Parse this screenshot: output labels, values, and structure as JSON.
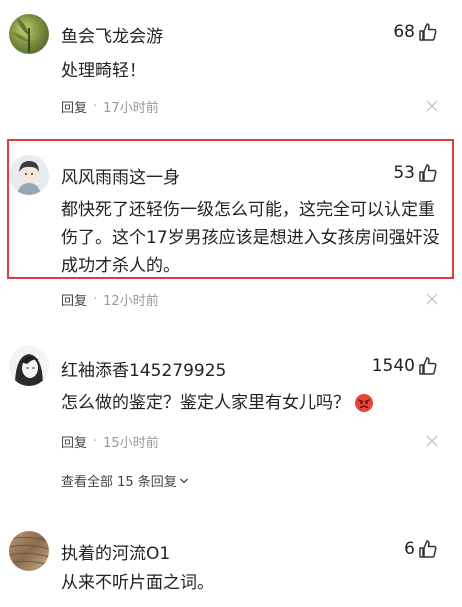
{
  "comments": [
    {
      "username": "鱼会飞龙会游",
      "likes": "68",
      "text": "处理畸轻！",
      "reply_label": "回复",
      "time": "17小时前",
      "avatar": "plant-avatar"
    },
    {
      "username": "风风雨雨这一身",
      "likes": "53",
      "text": "都快死了还轻伤一级怎么可能，这完全可以认定重伤了。这个17岁男孩应该是想进入女孩房间强奸没成功才杀人的。",
      "reply_label": "回复",
      "time": "12小时前",
      "avatar": "anime-boy-avatar"
    },
    {
      "username": "红袖添香145279925",
      "likes": "1540",
      "text": "怎么做的鉴定？鉴定人家里有女儿吗？",
      "emoji": "angry-face-emoji",
      "reply_label": "回复",
      "time": "15小时前",
      "avatar": "sketch-girl-avatar",
      "expand_label": "查看全部 15 条回复"
    },
    {
      "username": "执着的河流O1",
      "likes": "6",
      "text": "从来不听片面之词。",
      "avatar": "wood-texture-avatar"
    }
  ],
  "colors": {
    "highlight": "#e23b3b",
    "text": "#222222",
    "meta": "#999999"
  }
}
